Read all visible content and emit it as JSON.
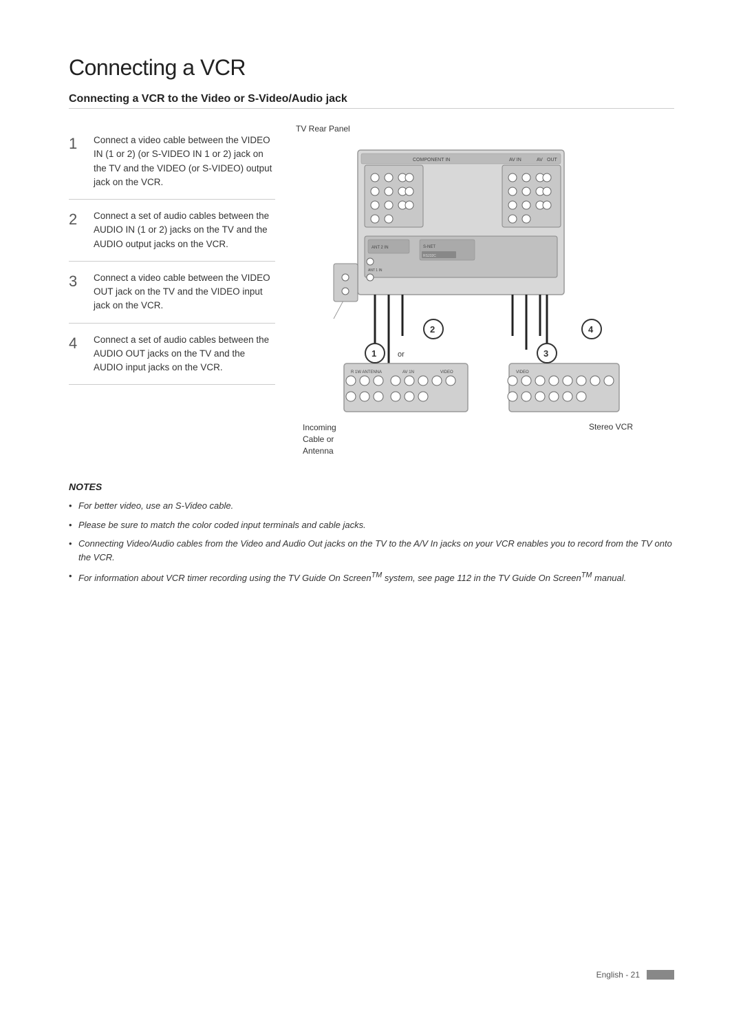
{
  "page": {
    "title": "Connecting a VCR",
    "section_heading": "Connecting a VCR to the Video or S-Video/Audio jack",
    "steps": [
      {
        "number": "1",
        "text": "Connect a video cable between the VIDEO IN (1 or 2) (or S-VIDEO IN 1 or 2) jack on the TV and the VIDEO (or S-VIDEO) output jack on the VCR."
      },
      {
        "number": "2",
        "text": "Connect a set of audio cables between the AUDIO IN (1 or 2) jacks on the TV and the AUDIO output jacks on the VCR."
      },
      {
        "number": "3",
        "text": "Connect a video cable between the VIDEO OUT jack on the TV and the VIDEO input jack on the VCR."
      },
      {
        "number": "4",
        "text": "Connect a set of audio cables between the AUDIO OUT jacks on the TV and the AUDIO input jacks on the VCR."
      }
    ],
    "diagram": {
      "tv_label": "TV Rear Panel",
      "vcr_label": "Stereo VCR",
      "incoming_label": "Incoming\nCable or\nAntenna"
    },
    "notes": {
      "title": "NOTES",
      "items": [
        "For better video, use an S-Video cable.",
        "Please be sure to match the color coded input terminals and cable jacks.",
        "Connecting Video/Audio cables from the Video and Audio Out jacks on the TV to the A/V In jacks on your VCR enables you to record from the TV onto the VCR.",
        "For information about VCR timer recording using the TV Guide On Screen™ system, see page 112 in the TV Guide On Screen™ manual."
      ]
    },
    "footer": {
      "text": "English - 21"
    }
  }
}
